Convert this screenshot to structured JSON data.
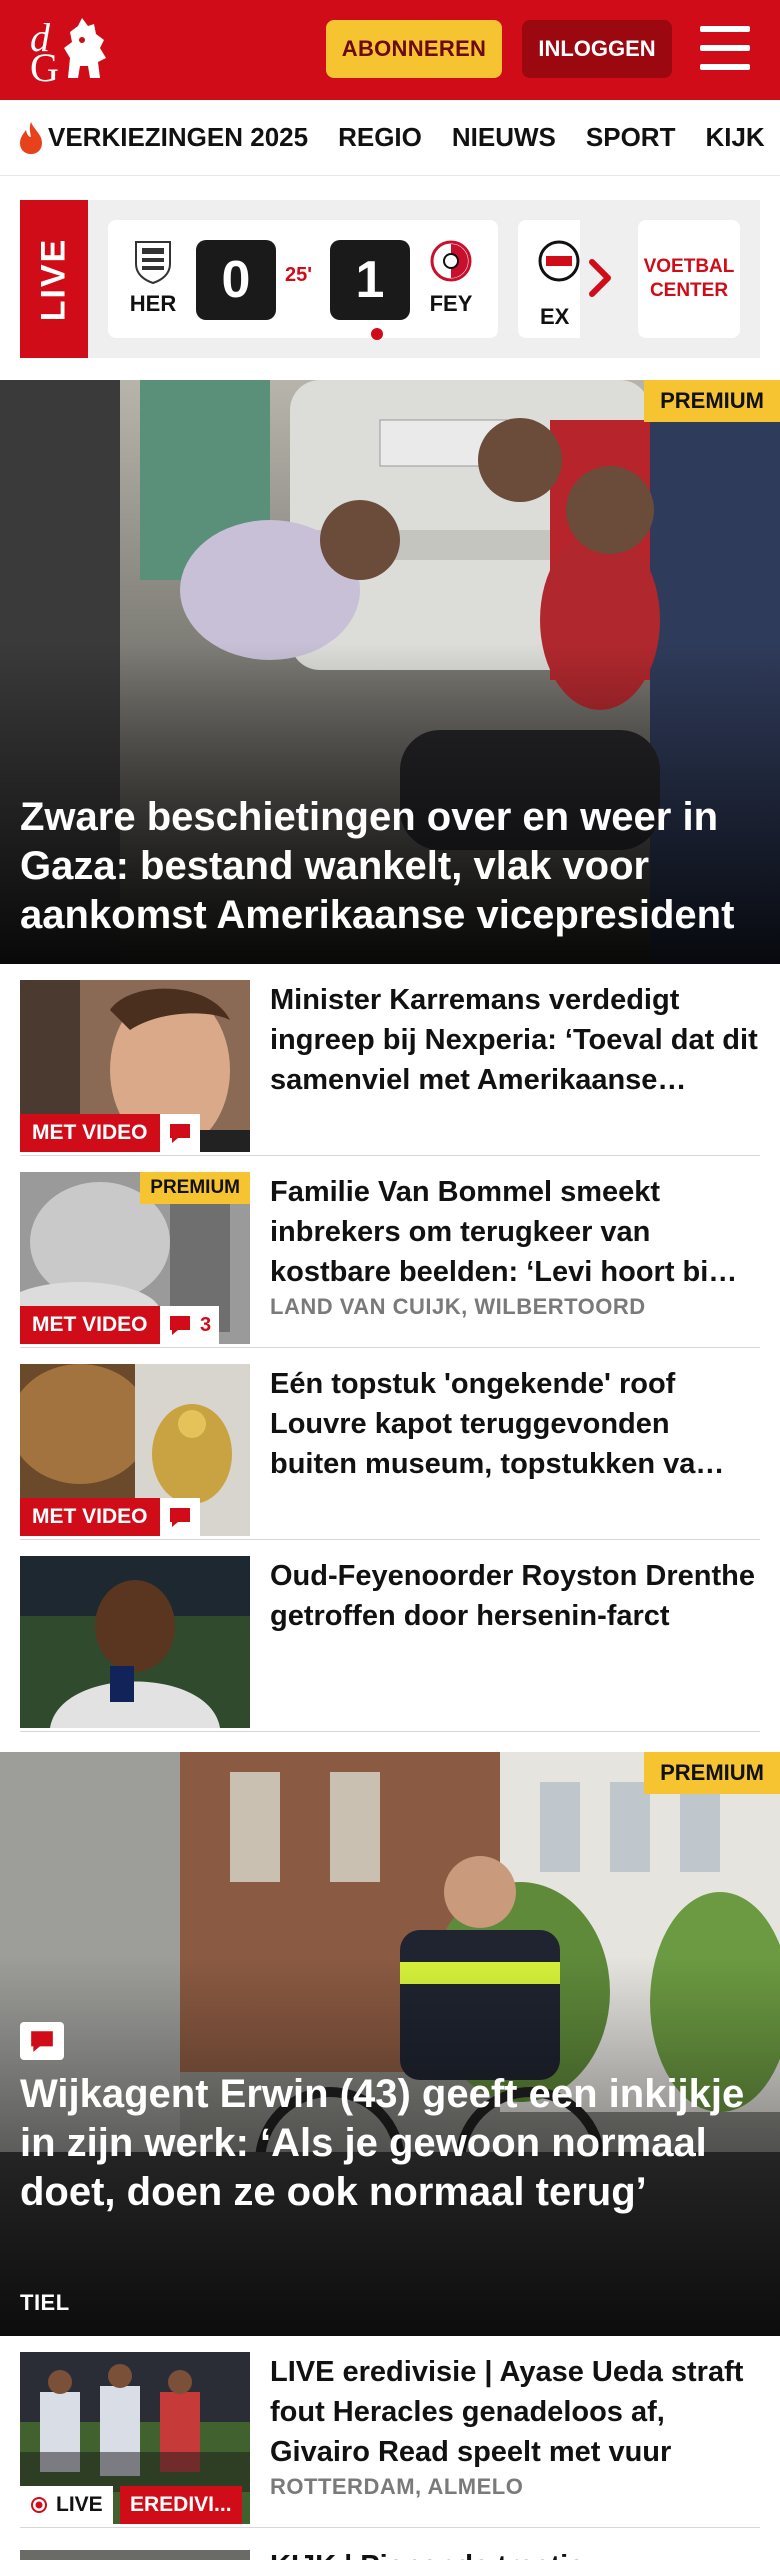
{
  "header": {
    "logo_text": "dG",
    "subscribe_label": "ABONNEREN",
    "login_label": "INLOGGEN"
  },
  "nav": {
    "items": [
      "VERKIEZINGEN 2025",
      "REGIO",
      "NIEUWS",
      "SPORT",
      "KIJK"
    ]
  },
  "live": {
    "tag": "LIVE",
    "match": {
      "home": "HER",
      "away": "FEY",
      "home_score": "0",
      "away_score": "1",
      "minute": "25'"
    },
    "next_team": "EX",
    "voetbal_center": "VOETBAL CENTER"
  },
  "hero": {
    "badge": "PREMIUM",
    "title": "Zware beschietingen over en weer in Gaza: bestand wankelt, vlak voor aankomst Amerikaanse vicepresident"
  },
  "articles": [
    {
      "title": "Minister Karremans verdedigt ingreep bij Nexperia: ‘Toeval dat dit samenviel met Amerikaanse…",
      "video_label": "MET VIDEO",
      "comments": "",
      "location": "",
      "premium": ""
    },
    {
      "title": "Familie Van Bommel smeekt inbrekers om terugkeer van kostbare beelden: ‘Levi hoort bi…",
      "video_label": "MET VIDEO",
      "comments": "3",
      "location": "LAND VAN CUIJK, WILBERTOORD",
      "premium": "PREMIUM"
    },
    {
      "title": "Eén topstuk 'ongekende' roof Louvre kapot teruggevonden buiten museum, topstukken va…",
      "video_label": "MET VIDEO",
      "comments": "",
      "location": "",
      "premium": ""
    },
    {
      "title": "Oud-Feyenoorder Royston Drenthe getroffen door hersenin-farct",
      "video_label": "",
      "comments": "",
      "location": "",
      "premium": ""
    }
  ],
  "feature": {
    "badge": "PREMIUM",
    "title": "Wijkagent Erwin (43) geeft een inkijkje in zijn werk: ‘Als je gewoon normaal doet, doen ze ook normaal terug’",
    "location": "TIEL"
  },
  "live_article": {
    "title": "LIVE eredivisie | Ayase Ueda straft fout Heracles genadeloos af, Givairo Read speelt met vuur",
    "location": "ROTTERDAM, ALMELO",
    "live_label": "LIVE",
    "competition": "EREDIVI..."
  },
  "next_article": {
    "title": "KIJK | Piepende tractie..."
  },
  "colors": {
    "brand_red": "#d00c19",
    "premium_yellow": "#f6c431",
    "dark_red": "#9b0810"
  }
}
